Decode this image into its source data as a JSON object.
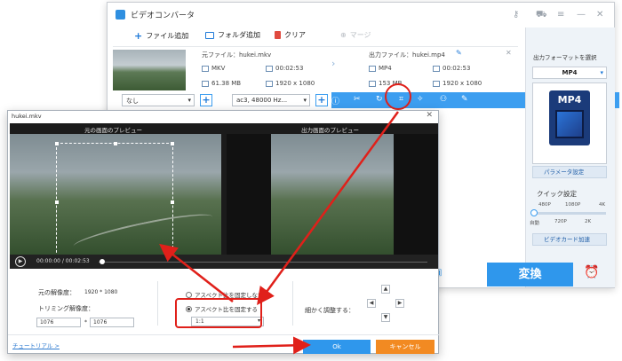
{
  "app": {
    "title": "ビデオコンバータ",
    "toolbar": {
      "add_file": "ファイル追加",
      "add_folder": "フォルダ追加",
      "clear": "クリア",
      "merge": "マージ"
    }
  },
  "file": {
    "src_name": "元ファイル：hukei.mkv",
    "src_format": "MKV",
    "src_duration": "00:02:53",
    "src_size": "61.38 MB",
    "src_resolution": "1920 x 1080",
    "out_name": "出力ファイル：hukei.mp4",
    "out_format": "MP4",
    "out_duration": "00:02:53",
    "out_size": "153 MB",
    "out_resolution": "1920 x 1080"
  },
  "editbar": {
    "subtitle": "なし",
    "audio": "ac3, 48000 Hz..."
  },
  "side": {
    "select_format_label": "出力フォーマットを選択",
    "format": "MP4",
    "param_button": "パラメータ設定",
    "quick_label": "クイック設定",
    "ticks_top": [
      "480P",
      "1080P",
      "4K"
    ],
    "ticks_bottom": [
      "自動",
      "720P",
      "2K"
    ],
    "gpu_button": "ビデオカード加速",
    "convert": "変換"
  },
  "dialog": {
    "title": "hukei.mkv",
    "orig_preview_label": "元の画面のプレビュー",
    "out_preview_label": "出力画面のプレビュー",
    "time": "00:00:00 / 00:02:53",
    "orig_res_label": "元の解像度：",
    "orig_res_value": "1920 * 1080",
    "trim_res_label": "トリミング解像度：",
    "trim_w": "1076",
    "trim_sep": "*",
    "trim_h": "1076",
    "radio_unlock": "アスペクト比を固定しない",
    "radio_lock": "アスペクト比を固定する",
    "ratio_value": "1:1",
    "fine_adjust_label": "細かく調整する：",
    "tutorial": "チュートリアル >",
    "ok": "Ok",
    "cancel": "キャンセル"
  },
  "colors": {
    "accent": "#2f97ec",
    "cancel": "#f28a22",
    "annotation": "#e0201a"
  }
}
